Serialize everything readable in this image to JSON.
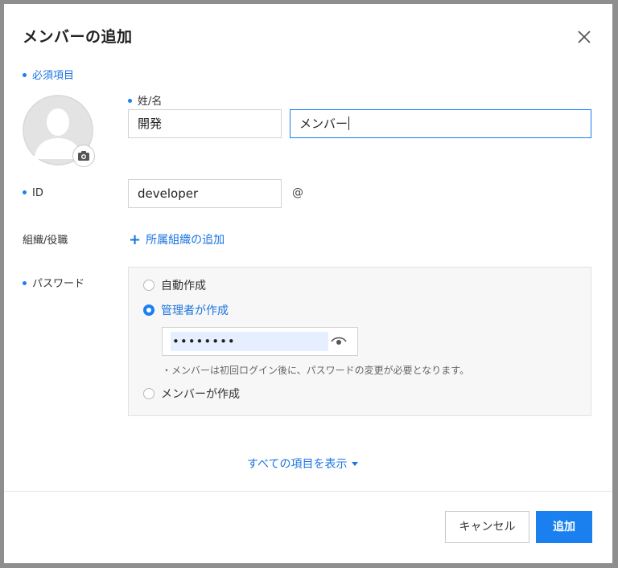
{
  "dialog": {
    "title": "メンバーの追加",
    "required_note": "必須項目"
  },
  "name": {
    "label": "姓/名",
    "last_name_value": "開発",
    "first_name_value": "メンバー"
  },
  "id": {
    "label": "ID",
    "value": "developer",
    "at_symbol": "@"
  },
  "org": {
    "label": "組織/役職",
    "add_label": "所属組織の追加"
  },
  "password": {
    "label": "パスワード",
    "options": [
      {
        "label": "自動作成",
        "selected": false
      },
      {
        "label": "管理者が作成",
        "selected": true
      },
      {
        "label": "メンバーが作成",
        "selected": false
      }
    ],
    "masked_value": "••••••••",
    "note": "・メンバーは初回ログイン後に、パスワードの変更が必要となります。"
  },
  "show_all": {
    "label": "すべての項目を表示"
  },
  "footer": {
    "cancel_label": "キャンセル",
    "add_label": "追加"
  },
  "colors": {
    "accent": "#1a80f0",
    "link": "#1a74e0",
    "backdrop": "#8e8e8e"
  },
  "icons": {
    "close": "close-icon",
    "avatar": "user-silhouette-icon",
    "camera": "camera-icon",
    "eye": "eye-icon",
    "plus": "plus-icon",
    "caret": "caret-down-icon"
  }
}
